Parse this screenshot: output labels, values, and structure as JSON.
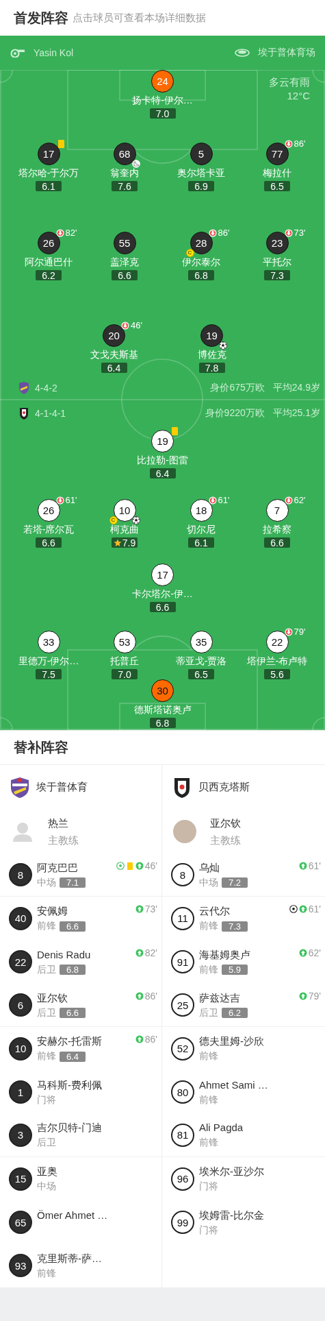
{
  "header": {
    "title": "首发阵容",
    "subtitle": "点击球员可查看本场详细数据"
  },
  "match_info": {
    "referee": "Yasin Kol",
    "stadium": "埃于普体育场",
    "weather": "多云有雨",
    "temperature": "12°C"
  },
  "lineup": {
    "teams": [
      {
        "formation": "4-4-2",
        "market_value": "身价675万欧",
        "average_age": "平均24.9岁",
        "lines": [
          [
            {
              "number": "24",
              "name": "扬卡特-伊尔…",
              "rating": "7.0",
              "goalkeeper": true,
              "yellow_card": false,
              "goal": false,
              "assist": false,
              "mvp": false
            }
          ],
          [
            {
              "number": "17",
              "name": "塔尔哈-于尔万",
              "rating": "6.1",
              "goalkeeper": false,
              "yellow_card": true,
              "goal": false,
              "assist": false,
              "mvp": false
            },
            {
              "number": "68",
              "name": "翁奎内",
              "rating": "7.6",
              "goalkeeper": false,
              "yellow_card": false,
              "goal": false,
              "assist": true,
              "mvp": false
            },
            {
              "number": "5",
              "name": "奥尔塔卡亚",
              "rating": "6.9",
              "goalkeeper": false,
              "yellow_card": false,
              "goal": false,
              "assist": false,
              "mvp": false
            },
            {
              "number": "77",
              "name": "梅拉什",
              "rating": "6.5",
              "goalkeeper": false,
              "yellow_card": false,
              "goal": false,
              "assist": false,
              "mvp": false,
              "sub_off": "86'"
            }
          ],
          [
            {
              "number": "26",
              "name": "阿尔通巴什",
              "rating": "6.2",
              "goalkeeper": false,
              "yellow_card": false,
              "goal": false,
              "assist": false,
              "mvp": false,
              "sub_off": "82'"
            },
            {
              "number": "55",
              "name": "盖泽克",
              "rating": "6.6",
              "goalkeeper": false,
              "yellow_card": false,
              "goal": false,
              "assist": false,
              "mvp": false
            },
            {
              "number": "28",
              "name": "伊尔泰尔",
              "rating": "6.8",
              "goalkeeper": false,
              "yellow_card": false,
              "goal": false,
              "assist": false,
              "mvp": false,
              "captain_badge": "C",
              "sub_off": "86'"
            },
            {
              "number": "23",
              "name": "平托尔",
              "rating": "7.3",
              "goalkeeper": false,
              "yellow_card": false,
              "goal": false,
              "assist": false,
              "mvp": false,
              "sub_off": "73'"
            }
          ],
          [
            {
              "number": "20",
              "name": "文戈夫斯基",
              "rating": "6.4",
              "goalkeeper": false,
              "yellow_card": false,
              "goal": false,
              "assist": false,
              "mvp": false,
              "sub_off": "46'"
            },
            {
              "number": "19",
              "name": "博佐克",
              "rating": "7.8",
              "goalkeeper": false,
              "yellow_card": false,
              "goal": true,
              "assist": false,
              "mvp": false
            }
          ]
        ]
      },
      {
        "formation": "4-1-4-1",
        "market_value": "身价9220万欧",
        "average_age": "平均25.1岁",
        "lines": [
          [
            {
              "number": "19",
              "name": "比拉勒-图雷",
              "rating": "6.4",
              "goalkeeper": false,
              "yellow_card": true,
              "goal": false,
              "assist": false,
              "mvp": false
            }
          ],
          [
            {
              "number": "26",
              "name": "若塔-席尔瓦",
              "rating": "6.6",
              "goalkeeper": false,
              "yellow_card": false,
              "goal": false,
              "assist": false,
              "mvp": false,
              "sub_off": "61'"
            },
            {
              "number": "10",
              "name": "柯克曲",
              "rating": "7.9",
              "goalkeeper": false,
              "yellow_card": false,
              "goal": true,
              "assist": false,
              "mvp": true,
              "captain_badge": "C"
            },
            {
              "number": "18",
              "name": "切尔尼",
              "rating": "6.1",
              "goalkeeper": false,
              "yellow_card": false,
              "goal": false,
              "assist": false,
              "mvp": false,
              "sub_off": "61'"
            },
            {
              "number": "7",
              "name": "拉希察",
              "rating": "6.6",
              "goalkeeper": false,
              "yellow_card": false,
              "goal": false,
              "assist": false,
              "mvp": false,
              "sub_off": "62'"
            }
          ],
          [
            {
              "number": "17",
              "name": "卡尔塔尔-伊…",
              "rating": "6.6",
              "goalkeeper": false,
              "yellow_card": false,
              "goal": false,
              "assist": false,
              "mvp": false
            }
          ],
          [
            {
              "number": "33",
              "name": "里德万-伊尔…",
              "rating": "7.5",
              "goalkeeper": false,
              "yellow_card": false,
              "goal": false,
              "assist": false,
              "mvp": false
            },
            {
              "number": "53",
              "name": "托普丘",
              "rating": "7.0",
              "goalkeeper": false,
              "yellow_card": false,
              "goal": false,
              "assist": false,
              "mvp": false
            },
            {
              "number": "35",
              "name": "蒂亚戈-贾洛",
              "rating": "6.5",
              "goalkeeper": false,
              "yellow_card": false,
              "goal": false,
              "assist": false,
              "mvp": false
            },
            {
              "number": "22",
              "name": "塔伊兰-布卢特",
              "rating": "5.6",
              "goalkeeper": false,
              "yellow_card": false,
              "goal": false,
              "assist": false,
              "mvp": false,
              "sub_off": "79'"
            }
          ],
          [
            {
              "number": "30",
              "name": "德斯塔诺奥卢",
              "rating": "6.8",
              "goalkeeper": true,
              "yellow_card": false,
              "goal": false,
              "assist": false,
              "mvp": false
            }
          ]
        ]
      }
    ]
  },
  "substitutes": {
    "title": "替补阵容",
    "teams": [
      {
        "name": "埃于普体育",
        "coach": {
          "name": "热兰",
          "role": "主教练",
          "has_photo": false
        },
        "players": [
          {
            "number": "8",
            "name": "阿克巴巴",
            "position": "中场",
            "rating": "7.1",
            "goal": false,
            "assist": true,
            "yellow_card": true,
            "sub_on": "46'"
          },
          {
            "number": "40",
            "name": "安佩姆",
            "position": "前锋",
            "rating": "6.6",
            "goal": false,
            "assist": false,
            "yellow_card": false,
            "sub_on": "73'"
          },
          {
            "number": "22",
            "name": "Denis Radu",
            "position": "后卫",
            "rating": "6.8",
            "goal": false,
            "assist": false,
            "yellow_card": false,
            "sub_on": "82'"
          },
          {
            "number": "6",
            "name": "亚尔钦",
            "position": "后卫",
            "rating": "6.6",
            "goal": false,
            "assist": false,
            "yellow_card": false,
            "sub_on": "86'"
          },
          {
            "number": "10",
            "name": "安赫尔-托雷斯",
            "position": "前锋",
            "rating": "6.4",
            "goal": false,
            "assist": false,
            "yellow_card": false,
            "sub_on": "86'"
          },
          {
            "number": "1",
            "name": "马科斯-费利佩",
            "position": "门将",
            "goal": false,
            "assist": false,
            "yellow_card": false
          },
          {
            "number": "3",
            "name": "吉尔贝特-门迪",
            "position": "后卫",
            "goal": false,
            "assist": false,
            "yellow_card": false
          },
          {
            "number": "15",
            "name": "亚奥",
            "position": "中场",
            "goal": false,
            "assist": false,
            "yellow_card": false
          },
          {
            "number": "65",
            "name": "Ömer Ahmet …",
            "goal": false,
            "assist": false,
            "yellow_card": false
          },
          {
            "number": "93",
            "name": "克里斯蒂-萨…",
            "position": "前锋",
            "goal": false,
            "assist": false,
            "yellow_card": false
          }
        ]
      },
      {
        "name": "贝西克塔斯",
        "coach": {
          "name": "亚尔钦",
          "role": "主教练",
          "has_photo": true
        },
        "players": [
          {
            "number": "8",
            "name": "乌灿",
            "position": "中场",
            "rating": "7.2",
            "goal": false,
            "assist": false,
            "yellow_card": false,
            "sub_on": "61'"
          },
          {
            "number": "11",
            "name": "云代尔",
            "position": "前锋",
            "rating": "7.3",
            "goal": true,
            "assist": false,
            "yellow_card": false,
            "sub_on": "61'"
          },
          {
            "number": "91",
            "name": "海基姆奥卢",
            "position": "前锋",
            "rating": "5.9",
            "goal": false,
            "assist": false,
            "yellow_card": false,
            "sub_on": "62'"
          },
          {
            "number": "25",
            "name": "萨兹达吉",
            "position": "后卫",
            "rating": "6.2",
            "goal": false,
            "assist": false,
            "yellow_card": false,
            "sub_on": "79'"
          },
          {
            "number": "52",
            "name": "德夫里姆-沙欣",
            "position": "前锋",
            "goal": false,
            "assist": false,
            "yellow_card": false
          },
          {
            "number": "80",
            "name": "Ahmet Sami …",
            "position": "前锋",
            "goal": false,
            "assist": false,
            "yellow_card": false
          },
          {
            "number": "81",
            "name": "Ali Pagda",
            "position": "前锋",
            "goal": false,
            "assist": false,
            "yellow_card": false
          },
          {
            "number": "96",
            "name": "埃米尔-亚沙尔",
            "position": "门将",
            "goal": false,
            "assist": false,
            "yellow_card": false
          },
          {
            "number": "99",
            "name": "埃姆雷-比尔金",
            "position": "门将",
            "goal": false,
            "assist": false,
            "yellow_card": false
          }
        ]
      }
    ]
  }
}
